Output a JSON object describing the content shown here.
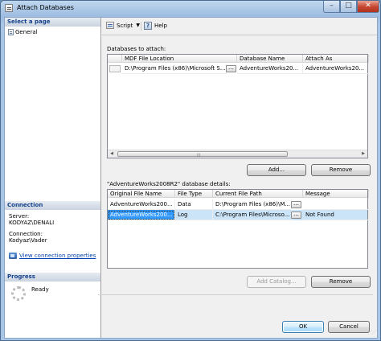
{
  "window": {
    "title": "Attach Databases"
  },
  "left_pane": {
    "select_page_header": "Select a page",
    "pages": [
      "General"
    ],
    "connection_header": "Connection",
    "server_label": "Server:",
    "server_value": "KODYAZ\\DENALI",
    "connection_label": "Connection:",
    "connection_value": "Kodyaz\\Vader",
    "view_props_link": "View connection properties",
    "progress_header": "Progress",
    "progress_status": "Ready"
  },
  "toolbar": {
    "script_label": "Script",
    "help_label": "Help"
  },
  "databases": {
    "label": "Databases to attach:",
    "columns": [
      "MDF File Location",
      "Database Name",
      "Attach As"
    ],
    "rows": [
      {
        "mdf": "D:\\Program Files (x86)\\Microsoft S...",
        "db_name": "AdventureWorks20...",
        "attach_as": "AdventureWorks20..."
      }
    ],
    "add_label": "Add...",
    "remove_label": "Remove"
  },
  "details": {
    "label": "\"AdventureWorks2008R2\" database details:",
    "columns": [
      "Original File Name",
      "File Type",
      "Current File Path",
      "Message"
    ],
    "rows": [
      {
        "name": "AdventureWorks200...",
        "type": "Data",
        "path": "D:\\Program Files (x86)\\M...",
        "message": ""
      },
      {
        "name": "AdventureWorks200...",
        "type": "Log",
        "path": "C:\\Program Files\\Microso...",
        "message": "Not Found"
      }
    ],
    "add_catalog_label": "Add Catalog...",
    "remove_label": "Remove"
  },
  "footer": {
    "ok_label": "OK",
    "cancel_label": "Cancel"
  },
  "icons": {
    "browse": "ellipsis",
    "close": "close-icon",
    "minimize": "minimize-icon",
    "maximize": "maximize-icon"
  }
}
